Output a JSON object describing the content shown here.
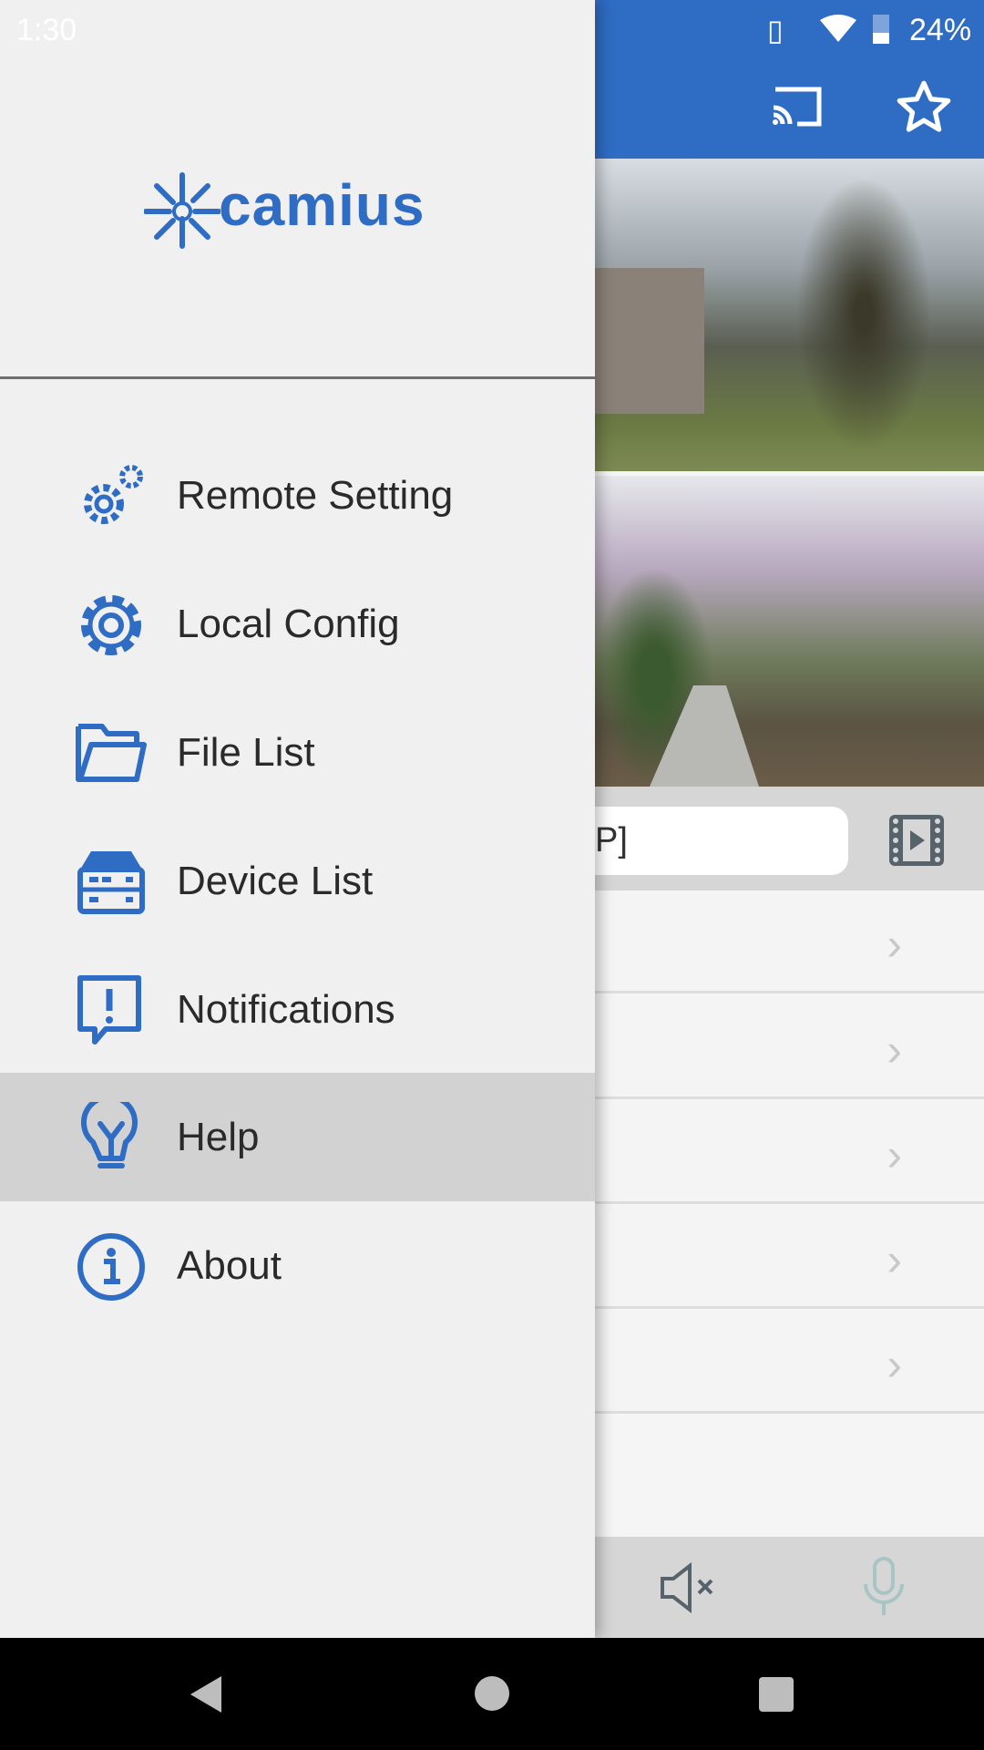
{
  "status_bar": {
    "time": "1:30",
    "battery": "24%"
  },
  "app": {
    "brand": "camius",
    "accent": "#2f6cc4",
    "input_value": "P]"
  },
  "drawer": {
    "items": [
      {
        "label": "Remote Setting",
        "icon": "gears-icon"
      },
      {
        "label": "Local Config",
        "icon": "gear-icon"
      },
      {
        "label": "File List",
        "icon": "folder-icon"
      },
      {
        "label": "Device List",
        "icon": "device-icon"
      },
      {
        "label": "Notifications",
        "icon": "alert-message-icon"
      },
      {
        "label": "Help",
        "icon": "lightbulb-icon",
        "selected": true
      },
      {
        "label": "About",
        "icon": "info-icon"
      }
    ]
  }
}
